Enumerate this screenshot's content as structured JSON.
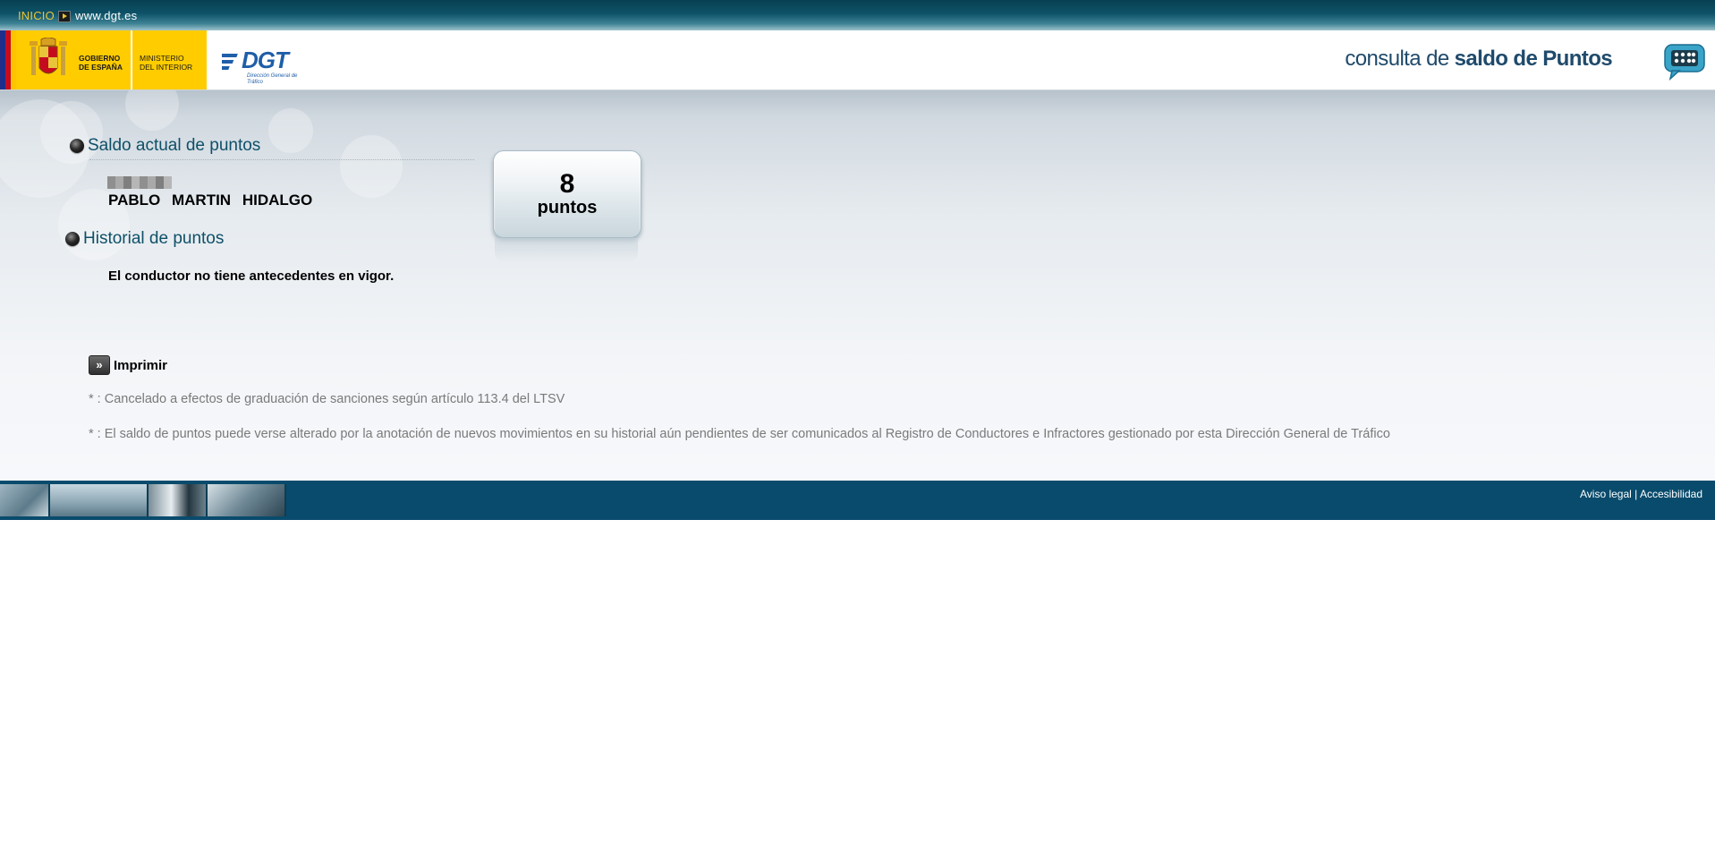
{
  "topbar": {
    "inicio": "INICIO",
    "site": "www.dgt.es"
  },
  "header": {
    "gov_line1": "GOBIERNO",
    "gov_line2": "DE ESPAÑA",
    "ministry_line1": "MINISTERIO",
    "ministry_line2": "DEL INTERIOR",
    "dgt_logo": "DGT",
    "dgt_sub": "Dirección General de Tráfico",
    "brand_prefix": "consulta de",
    "brand_bold": "saldo de Puntos",
    "brand_icon": "speech-bubble-keypad-icon"
  },
  "saldo": {
    "title": "Saldo actual de puntos",
    "first_name": "PABLO",
    "surname1": "MARTIN",
    "surname2": "HIDALGO",
    "points_value": "8",
    "points_label": "puntos"
  },
  "historial": {
    "title": "Historial de puntos",
    "message": "El conductor no tiene antecedentes en vigor."
  },
  "print_label": "Imprimir",
  "notes": [
    "* : Cancelado a efectos de graduación de sanciones según artículo 113.4 del LTSV",
    "* : El saldo de puntos puede verse alterado por la anotación de nuevos movimientos en su historial aún pendientes de ser comunicados al Registro de Conductores e Infractores gestionado por esta Dirección General de Tráfico"
  ],
  "footer": {
    "aviso_legal": "Aviso legal",
    "separator": "|",
    "accesibilidad": "Accesibilidad"
  },
  "colors": {
    "topbar": "#0e5368",
    "gov_yellow": "#ffcc00",
    "section_title": "#0f5068",
    "footer": "#094b6c"
  }
}
